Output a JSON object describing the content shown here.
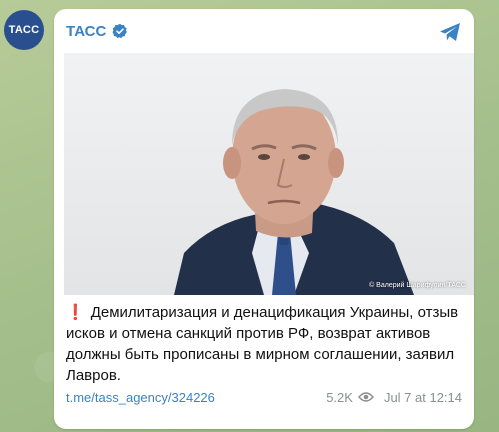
{
  "avatar": {
    "text": "ТАСС"
  },
  "channel": {
    "name": "ТАСС",
    "verified": true
  },
  "photo": {
    "credit": "© Валерий Шарифулин/ТАСС"
  },
  "post": {
    "text": "Демилитаризация и денацификация Украины, отзыв исков и отмена санкций против РФ, возврат активов должны быть прописаны в мирном соглашении, заявил Лавров.",
    "link": "t.me/tass_agency/324226",
    "views": "5.2K",
    "time": "Jul 7 at 12:14"
  },
  "colors": {
    "accent": "#3a82c5",
    "avatar_bg": "#2a4f8f",
    "exclamation": "#c62828"
  },
  "icons": [
    "verified-icon",
    "share-icon",
    "exclamation-icon",
    "views-eye-icon"
  ]
}
